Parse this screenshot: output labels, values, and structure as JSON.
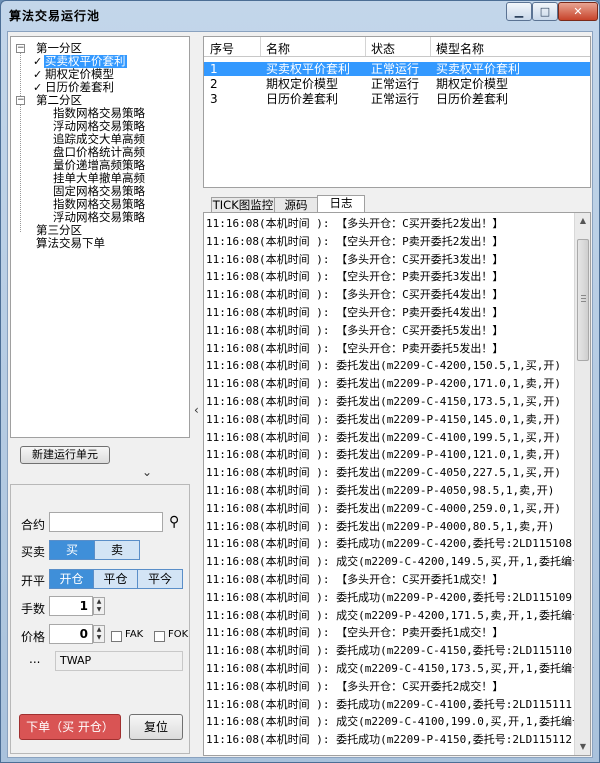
{
  "window": {
    "title": "算法交易运行池",
    "min_glyph": "▁",
    "max_glyph": "□",
    "close_glyph": "✕"
  },
  "tree": {
    "groups": [
      {
        "label": "第一分区",
        "expander": "−"
      },
      {
        "label": "第二分区",
        "expander": "−"
      },
      {
        "label": "第三分区"
      },
      {
        "label": "算法交易下单"
      }
    ],
    "group1_items": [
      {
        "label": "买卖权平价套利",
        "checked": true,
        "selected": true
      },
      {
        "label": "期权定价模型",
        "checked": true
      },
      {
        "label": "日历价差套利",
        "checked": true
      }
    ],
    "group2_items": [
      "指数网格交易策略",
      "浮动网格交易策略",
      "追踪成交大单高频",
      "盘口价格统计高频",
      "量价递增高频策略",
      "挂单大单撤单高频",
      "固定网格交易策略",
      "指数网格交易策略",
      "浮动网格交易策略"
    ],
    "check_glyph": "✓"
  },
  "left": {
    "new_unit_button": "新建运行单元",
    "collapse_glyph": "⌄"
  },
  "order": {
    "contract_label": "合约",
    "contract_value": "",
    "search_glyph": "⚲",
    "side_label": "买卖",
    "side_options": [
      "买",
      "卖"
    ],
    "side_selected": "买",
    "offset_label": "开平",
    "offset_options": [
      "开仓",
      "平仓",
      "平今"
    ],
    "offset_selected": "开仓",
    "qty_label": "手数",
    "qty_value": "1",
    "price_label": "价格",
    "price_value": "0",
    "fak_label": "FAK",
    "fok_label": "FOK",
    "more_glyph": "...",
    "price_type": "TWAP",
    "submit_button": "下单（买 开仓）",
    "reset_button": "复位"
  },
  "splitter_glyph": "‹",
  "grid": {
    "headers": [
      "序号",
      "名称",
      "状态",
      "模型名称"
    ],
    "rows": [
      {
        "no": "1",
        "name": "买卖权平价套利",
        "status": "正常运行",
        "model": "买卖权平价套利",
        "selected": true
      },
      {
        "no": "2",
        "name": "期权定价模型",
        "status": "正常运行",
        "model": "期权定价模型"
      },
      {
        "no": "3",
        "name": "日历价差套利",
        "status": "正常运行",
        "model": "日历价差套利"
      }
    ]
  },
  "tabs": [
    {
      "label": "TICK图监控"
    },
    {
      "label": "源码"
    },
    {
      "label": "日志",
      "active": true
    }
  ],
  "log": {
    "lines": [
      "11:16:08(本机时间  ): 【多头开仓：C买开委托2发出！】",
      "11:16:08(本机时间  ): 【空头开仓：P卖开委托2发出！】",
      "11:16:08(本机时间  ): 【多头开仓：C买开委托3发出！】",
      "11:16:08(本机时间  ): 【空头开仓：P卖开委托3发出！】",
      "11:16:08(本机时间  ): 【多头开仓：C买开委托4发出！】",
      "11:16:08(本机时间  ): 【空头开仓：P卖开委托4发出！】",
      "11:16:08(本机时间  ): 【多头开仓：C买开委托5发出！】",
      "11:16:08(本机时间  ): 【空头开仓：P卖开委托5发出！】",
      "11:16:08(本机时间  ): 委托发出(m2209-C-4200,150.5,1,买,开)",
      "11:16:08(本机时间  ): 委托发出(m2209-P-4200,171.0,1,卖,开)",
      "11:16:08(本机时间  ): 委托发出(m2209-C-4150,173.5,1,买,开)",
      "11:16:08(本机时间  ): 委托发出(m2209-P-4150,145.0,1,卖,开)",
      "11:16:08(本机时间  ): 委托发出(m2209-C-4100,199.5,1,买,开)",
      "11:16:08(本机时间  ): 委托发出(m2209-P-4100,121.0,1,卖,开)",
      "11:16:08(本机时间  ): 委托发出(m2209-C-4050,227.5,1,买,开)",
      "11:16:08(本机时间  ): 委托发出(m2209-P-4050,98.5,1,卖,开)",
      "11:16:08(本机时间  ): 委托发出(m2209-C-4000,259.0,1,买,开)",
      "11:16:08(本机时间  ): 委托发出(m2209-P-4000,80.5,1,卖,开)",
      "11:16:08(本机时间  ): 委托成功(m2209-C-4200,委托号:2LD115108)",
      "11:16:08(本机时间  ): 成交(m2209-C-4200,149.5,买,开,1,委托编号",
      "11:16:08(本机时间  ): 【多头开仓：C买开委托1成交！】",
      "11:16:08(本机时间  ): 委托成功(m2209-P-4200,委托号:2LD115109)",
      "11:16:08(本机时间  ): 成交(m2209-P-4200,171.5,卖,开,1,委托编号",
      "11:16:08(本机时间  ): 【空头开仓：P卖开委托1成交！】",
      "11:16:08(本机时间  ): 委托成功(m2209-C-4150,委托号:2LD115110)",
      "11:16:08(本机时间  ): 成交(m2209-C-4150,173.5,买,开,1,委托编号",
      "11:16:08(本机时间  ): 【多头开仓：C买开委托2成交！】",
      "11:16:08(本机时间  ): 委托成功(m2209-C-4100,委托号:2LD115111)",
      "11:16:08(本机时间  ): 成交(m2209-C-4100,199.0,买,开,1,委托编号",
      "11:16:08(本机时间  ): 委托成功(m2209-P-4150,委托号:2LD115112)"
    ]
  }
}
